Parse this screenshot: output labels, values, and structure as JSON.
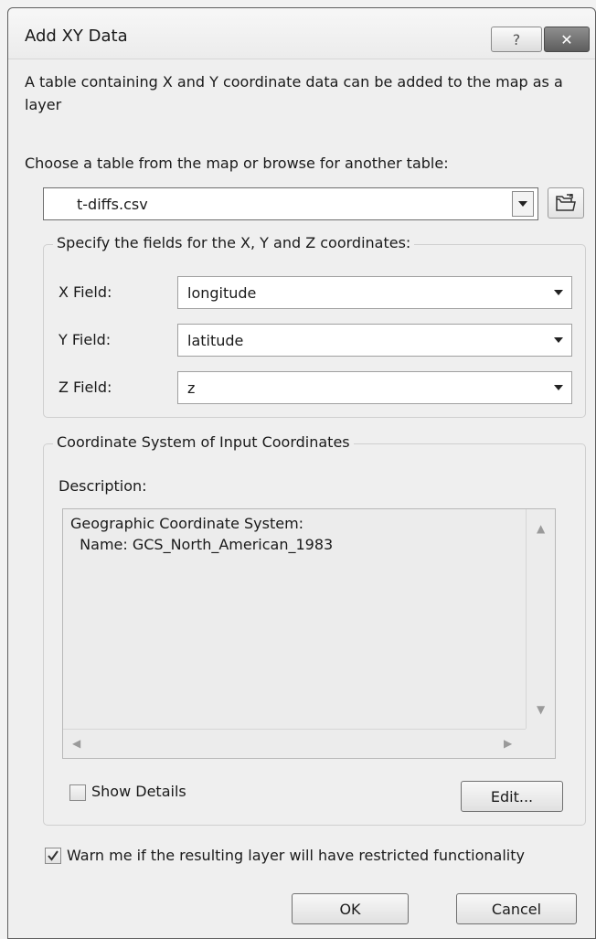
{
  "window": {
    "title": "Add XY Data",
    "help_symbol": "?",
    "close_symbol": "✕"
  },
  "intro_text": "A table containing X and Y coordinate data can be added to the map as a layer",
  "table_select": {
    "label": "Choose a table from the map or browse for another table:",
    "value": "t-diffs.csv",
    "browse_icon": "open-folder-icon"
  },
  "fields_group": {
    "title": "Specify the fields for the X, Y and Z coordinates:",
    "fields": [
      {
        "label": "X Field:",
        "value": "longitude"
      },
      {
        "label": "Y Field:",
        "value": "latitude"
      },
      {
        "label": "Z Field:",
        "value": "z"
      }
    ]
  },
  "coord_group": {
    "title": "Coordinate System of Input Coordinates",
    "description_label": "Description:",
    "description_text": "Geographic Coordinate System:\n  Name: GCS_North_American_1983",
    "show_details_label": "Show Details",
    "show_details_checked": false,
    "edit_label": "Edit..."
  },
  "warn": {
    "label": "Warn me if the resulting layer will have restricted functionality",
    "checked": true
  },
  "buttons": {
    "ok": "OK",
    "cancel": "Cancel"
  },
  "colors": {
    "dialog_bg": "#efefef",
    "close_button": "#6b6b6b",
    "border": "#5e5e5e"
  }
}
